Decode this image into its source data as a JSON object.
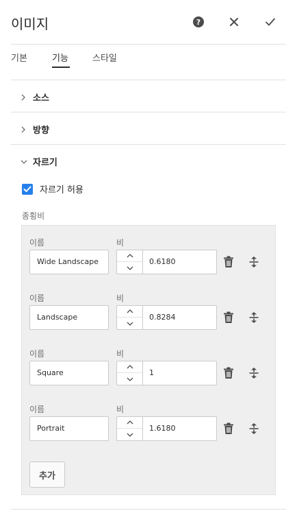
{
  "dialog": {
    "title": "이미지",
    "help_icon": "question-circle-icon",
    "close_icon": "close-icon",
    "done_icon": "checkmark-icon"
  },
  "tabs": [
    {
      "label": "기본",
      "active": false
    },
    {
      "label": "기능",
      "active": true
    },
    {
      "label": "스타일",
      "active": false
    }
  ],
  "sections": {
    "source": {
      "label": "소스",
      "expanded": false
    },
    "orientation": {
      "label": "방향",
      "expanded": false
    },
    "crop": {
      "label": "자르기",
      "expanded": true
    }
  },
  "crop": {
    "allow_crop": {
      "label": "자르기 허용",
      "checked": true
    },
    "aspect_ratios_label": "종횡비",
    "name_label": "이름",
    "ratio_label": "비",
    "items": [
      {
        "name": "Wide Landscape",
        "ratio": "0.6180"
      },
      {
        "name": "Landscape",
        "ratio": "0.8284"
      },
      {
        "name": "Square",
        "ratio": "1"
      },
      {
        "name": "Portrait",
        "ratio": "1.6180"
      }
    ],
    "add_label": "추가"
  },
  "colors": {
    "accent": "#2680eb",
    "text": "#2c2c2c",
    "muted": "#6e6e6e"
  }
}
